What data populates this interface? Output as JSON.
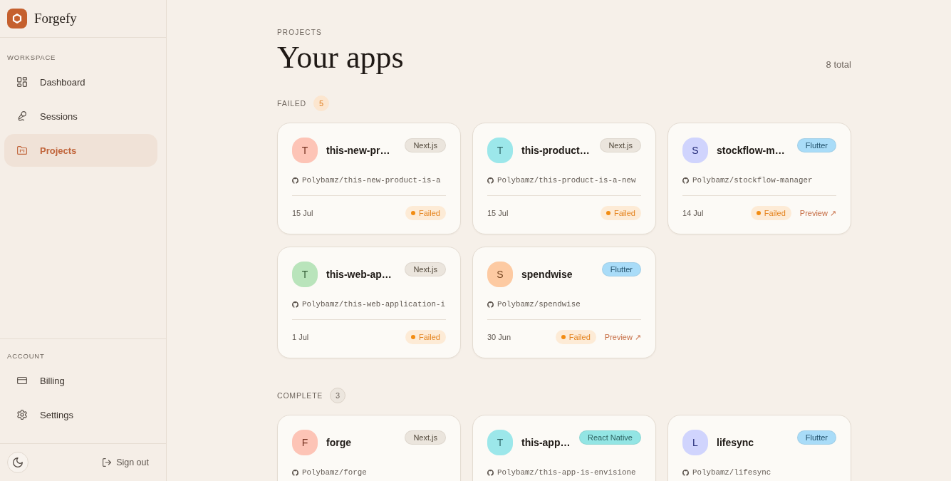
{
  "sidebar": {
    "brand": "Forgefy",
    "groups": [
      {
        "heading": "WORKSPACE",
        "items": [
          {
            "label": "Dashboard",
            "selected": false
          },
          {
            "label": "Sessions",
            "selected": false
          },
          {
            "label": "Projects",
            "selected": true
          }
        ]
      },
      {
        "heading": "ACCOUNT",
        "items": [
          {
            "label": "Billing",
            "selected": false
          },
          {
            "label": "Settings",
            "selected": false
          }
        ]
      }
    ],
    "sign_out": "Sign out"
  },
  "header": {
    "eyebrow": "PROJECTS",
    "title": "Your apps",
    "total": "8 total"
  },
  "sections": [
    {
      "title": "FAILED",
      "kind": "failed",
      "count": "5",
      "apps": [
        {
          "avatar": {
            "letter": "T",
            "color": "#fdc4b6"
          },
          "name": "this-new-pr…",
          "tag": {
            "label": "Next.js",
            "color": "#ebe5dd"
          },
          "repo": "Polybamz/this-new-product-is-a",
          "date": "15 Jul",
          "status": {
            "label": "Failed",
            "kind": "failed"
          }
        },
        {
          "avatar": {
            "letter": "T",
            "color": "#9ce7ea"
          },
          "name": "this-product…",
          "tag": {
            "label": "Next.js",
            "color": "#ebe5dd"
          },
          "repo": "Polybamz/this-product-is-a-new",
          "date": "15 Jul",
          "status": {
            "label": "Failed",
            "kind": "failed"
          }
        },
        {
          "avatar": {
            "letter": "S",
            "color": "#d0d4fd"
          },
          "name": "stockflow-m…",
          "tag": {
            "label": "Flutter",
            "color": "#a9dcf8"
          },
          "repo": "Polybamz/stockflow-manager",
          "date": "14 Jul",
          "status": {
            "label": "Failed",
            "kind": "failed"
          },
          "preview": "Preview ↗"
        },
        {
          "avatar": {
            "letter": "T",
            "color": "#b9e4bb"
          },
          "name": "this-web-ap…",
          "tag": {
            "label": "Next.js",
            "color": "#ebe5dd"
          },
          "repo": "Polybamz/this-web-application-i",
          "date": "1 Jul",
          "status": {
            "label": "Failed",
            "kind": "failed"
          }
        },
        {
          "avatar": {
            "letter": "S",
            "color": "#fdcaa2"
          },
          "name": "spendwise",
          "tag": {
            "label": "Flutter",
            "color": "#a9dcf8"
          },
          "repo": "Polybamz/spendwise",
          "date": "30 Jun",
          "status": {
            "label": "Failed",
            "kind": "failed"
          },
          "preview": "Preview ↗"
        }
      ]
    },
    {
      "title": "COMPLETE",
      "kind": "complete",
      "count": "3",
      "apps": [
        {
          "avatar": {
            "letter": "F",
            "color": "#fdc4b6"
          },
          "name": "forge",
          "tag": {
            "label": "Next.js",
            "color": "#ebe5dd"
          },
          "repo": "Polybamz/forge"
        },
        {
          "avatar": {
            "letter": "T",
            "color": "#9ce7ea"
          },
          "name": "this-app…",
          "tag": {
            "label": "React Native",
            "color": "#93e5e4"
          },
          "repo": "Polybamz/this-app-is-envisione"
        },
        {
          "avatar": {
            "letter": "L",
            "color": "#d0d4fd"
          },
          "name": "lifesync",
          "tag": {
            "label": "Flutter",
            "color": "#a9dcf8"
          },
          "repo": "Polybamz/lifesync"
        }
      ]
    }
  ]
}
